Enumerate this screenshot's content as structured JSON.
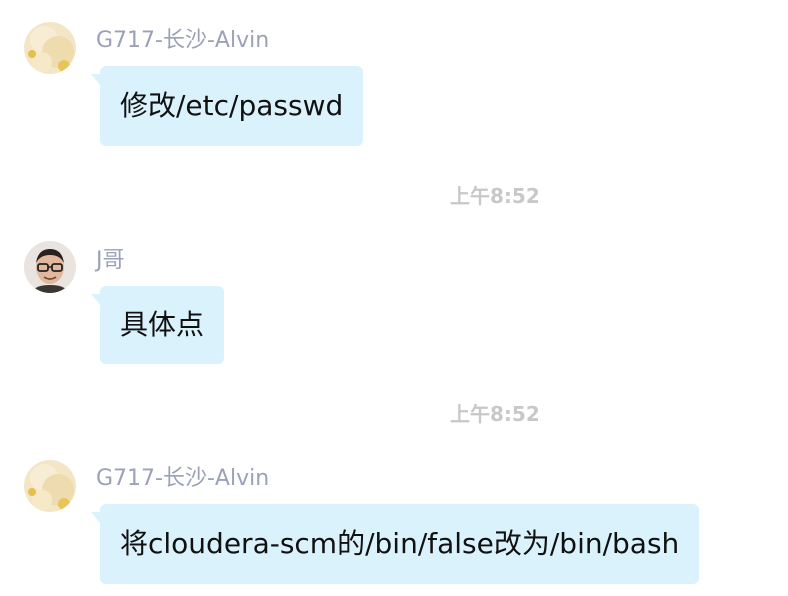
{
  "messages": [
    {
      "sender": "G717-长沙-Alvin",
      "text": "修改/etc/passwd"
    },
    {
      "sender": "J哥",
      "text": "具体点"
    },
    {
      "sender": "G717-长沙-Alvin",
      "text": "将cloudera-scm的/bin/false改为/bin/bash"
    }
  ],
  "timestamps": [
    "上午8:52",
    "上午8:52"
  ],
  "colors": {
    "bubble": "#daf2fc",
    "sender_name": "#9aa1b8",
    "timestamp": "#c8c8c8"
  }
}
